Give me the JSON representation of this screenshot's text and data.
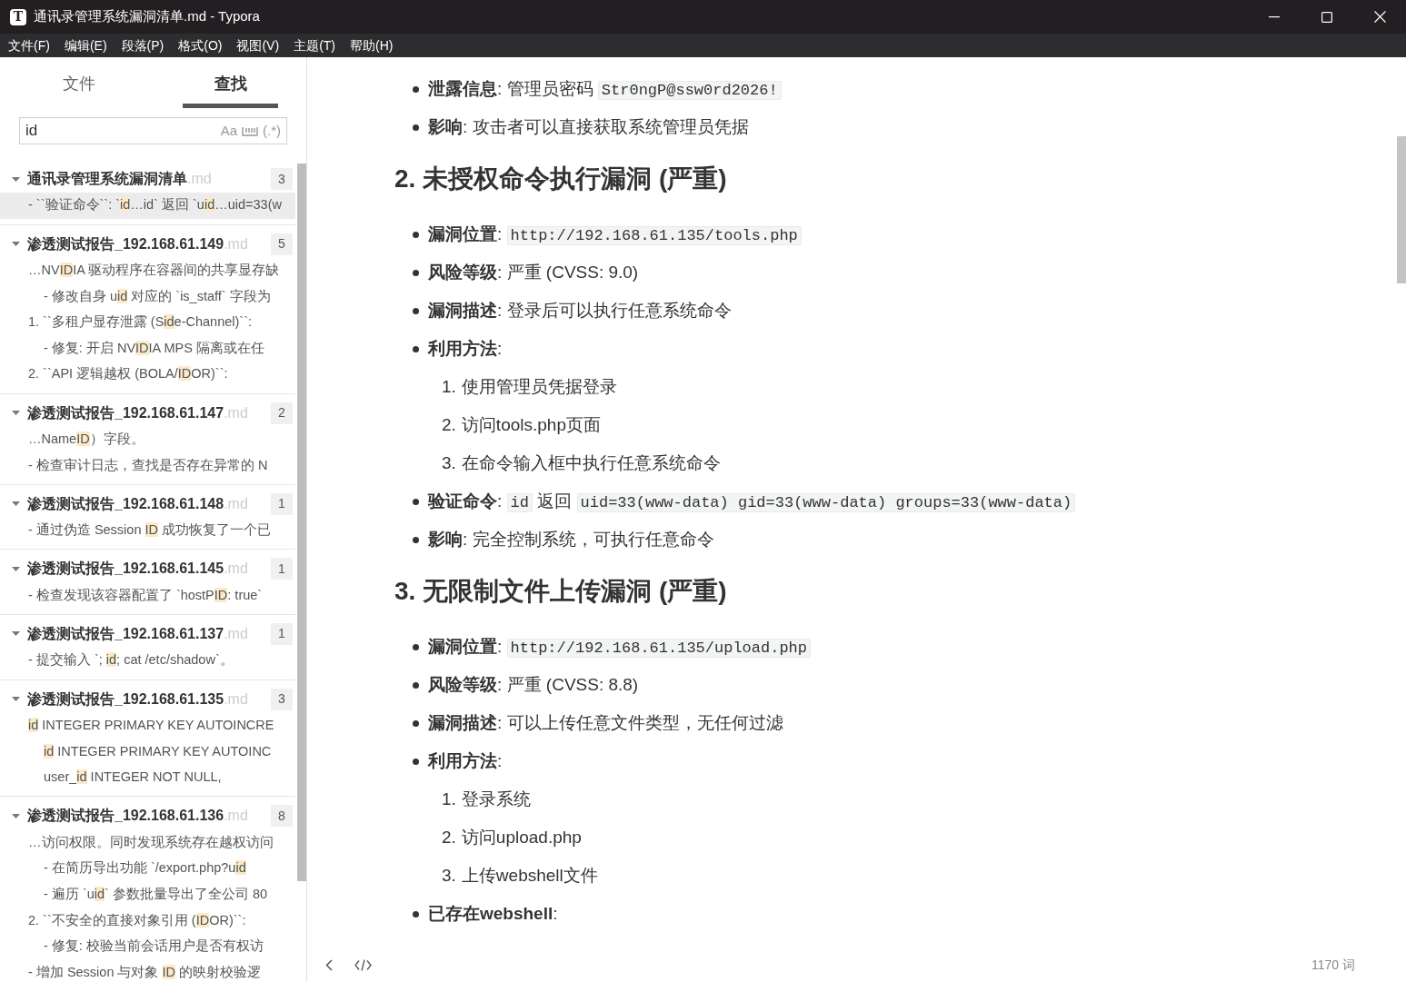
{
  "window": {
    "icon_text": "T",
    "title": "通讯录管理系统漏洞清单.md - Typora"
  },
  "menu": [
    "文件(F)",
    "编辑(E)",
    "段落(P)",
    "格式(O)",
    "视图(V)",
    "主题(T)",
    "帮助(H)"
  ],
  "sidebar": {
    "tabs": [
      {
        "label": "文件",
        "selected": false
      },
      {
        "label": "查找",
        "selected": true
      }
    ],
    "search": {
      "value": "id",
      "options": [
        {
          "kind": "text",
          "label": "Aa"
        },
        {
          "kind": "whole-word"
        },
        {
          "kind": "text",
          "label": "(.*)"
        }
      ]
    },
    "results": [
      {
        "name": "通讯录管理系统漏洞清单",
        "ext": ".md",
        "count": "3",
        "expanded": true,
        "matches": [
          {
            "selected": true,
            "indented": false,
            "segments": [
              {
                "text": "- ``验证命令``: `",
                "highlighted": false
              },
              {
                "text": "id",
                "highlighted": true
              },
              {
                "text": "…id` 返回 `u",
                "highlighted": false
              },
              {
                "text": "id",
                "highlighted": true
              },
              {
                "text": "…uid=33(w",
                "highlighted": false
              }
            ]
          }
        ]
      },
      {
        "name": "渗透测试报告_192.168.61.149",
        "ext": ".md",
        "count": "5",
        "expanded": true,
        "matches": [
          {
            "selected": false,
            "indented": false,
            "segments": [
              {
                "text": "…NV",
                "highlighted": false
              },
              {
                "text": "ID",
                "highlighted": true
              },
              {
                "text": "IA 驱动程序在容器间的共享显存缺",
                "highlighted": false
              }
            ]
          },
          {
            "selected": false,
            "indented": true,
            "segments": [
              {
                "text": "- 修改自身 u",
                "highlighted": false
              },
              {
                "text": "id",
                "highlighted": true
              },
              {
                "text": " 对应的 `is_staff` 字段为",
                "highlighted": false
              }
            ]
          },
          {
            "selected": false,
            "indented": false,
            "segments": [
              {
                "text": "1. ``多租户显存泄露 (S",
                "highlighted": false
              },
              {
                "text": "id",
                "highlighted": true
              },
              {
                "text": "e-Channel)``:",
                "highlighted": false
              }
            ]
          },
          {
            "selected": false,
            "indented": true,
            "segments": [
              {
                "text": "- 修复: 开启 NV",
                "highlighted": false
              },
              {
                "text": "ID",
                "highlighted": true
              },
              {
                "text": "IA MPS 隔离或在任",
                "highlighted": false
              }
            ]
          },
          {
            "selected": false,
            "indented": false,
            "segments": [
              {
                "text": "2. ``API 逻辑越权 (BOLA/",
                "highlighted": false
              },
              {
                "text": "ID",
                "highlighted": true
              },
              {
                "text": "OR)``:",
                "highlighted": false
              }
            ]
          }
        ]
      },
      {
        "name": "渗透测试报告_192.168.61.147",
        "ext": ".md",
        "count": "2",
        "expanded": true,
        "matches": [
          {
            "selected": false,
            "indented": false,
            "segments": [
              {
                "text": "…Name",
                "highlighted": false
              },
              {
                "text": "ID",
                "highlighted": true
              },
              {
                "text": "）字段。",
                "highlighted": false
              }
            ]
          },
          {
            "selected": false,
            "indented": false,
            "segments": [
              {
                "text": "- 检查审计日志，查找是否存在异常的 N",
                "highlighted": false
              }
            ]
          }
        ]
      },
      {
        "name": "渗透测试报告_192.168.61.148",
        "ext": ".md",
        "count": "1",
        "expanded": true,
        "matches": [
          {
            "selected": false,
            "indented": false,
            "segments": [
              {
                "text": "- 通过伪造 Session ",
                "highlighted": false
              },
              {
                "text": "ID",
                "highlighted": true
              },
              {
                "text": " 成功恢复了一个已",
                "highlighted": false
              }
            ]
          }
        ]
      },
      {
        "name": "渗透测试报告_192.168.61.145",
        "ext": ".md",
        "count": "1",
        "expanded": true,
        "matches": [
          {
            "selected": false,
            "indented": false,
            "segments": [
              {
                "text": "- 检查发现该容器配置了 `hostP",
                "highlighted": false
              },
              {
                "text": "ID",
                "highlighted": true
              },
              {
                "text": ": true`",
                "highlighted": false
              }
            ]
          }
        ]
      },
      {
        "name": "渗透测试报告_192.168.61.137",
        "ext": ".md",
        "count": "1",
        "expanded": true,
        "matches": [
          {
            "selected": false,
            "indented": false,
            "segments": [
              {
                "text": "- 提交输入 `; ",
                "highlighted": false
              },
              {
                "text": "id",
                "highlighted": true
              },
              {
                "text": "; cat /etc/shadow`。",
                "highlighted": false
              }
            ]
          }
        ]
      },
      {
        "name": "渗透测试报告_192.168.61.135",
        "ext": ".md",
        "count": "3",
        "expanded": true,
        "matches": [
          {
            "selected": false,
            "indented": false,
            "segments": [
              {
                "text": "id",
                "highlighted": true
              },
              {
                "text": " INTEGER PRIMARY KEY AUTOINCRE",
                "highlighted": false
              }
            ]
          },
          {
            "selected": false,
            "indented": true,
            "segments": [
              {
                "text": "id",
                "highlighted": true
              },
              {
                "text": " INTEGER PRIMARY KEY AUTOINC",
                "highlighted": false
              }
            ]
          },
          {
            "selected": false,
            "indented": true,
            "segments": [
              {
                "text": "user_",
                "highlighted": false
              },
              {
                "text": "id",
                "highlighted": true
              },
              {
                "text": " INTEGER NOT NULL,",
                "highlighted": false
              }
            ]
          }
        ]
      },
      {
        "name": "渗透测试报告_192.168.61.136",
        "ext": ".md",
        "count": "8",
        "expanded": true,
        "matches": [
          {
            "selected": false,
            "indented": false,
            "segments": [
              {
                "text": "…访问权限。同时发现系统存在越权访问",
                "highlighted": false
              }
            ]
          },
          {
            "selected": false,
            "indented": true,
            "segments": [
              {
                "text": "- 在简历导出功能 `/export.php?u",
                "highlighted": false
              },
              {
                "text": "id",
                "highlighted": true
              }
            ]
          },
          {
            "selected": false,
            "indented": true,
            "segments": [
              {
                "text": "- 遍历 `u",
                "highlighted": false
              },
              {
                "text": "id",
                "highlighted": true
              },
              {
                "text": "` 参数批量导出了全公司 80",
                "highlighted": false
              }
            ]
          },
          {
            "selected": false,
            "indented": false,
            "segments": [
              {
                "text": "2. ``不安全的直接对象引用 (",
                "highlighted": false
              },
              {
                "text": "ID",
                "highlighted": true
              },
              {
                "text": "OR)``:",
                "highlighted": false
              }
            ]
          },
          {
            "selected": false,
            "indented": true,
            "segments": [
              {
                "text": "- 修复: 校验当前会话用户是否有权访",
                "highlighted": false
              }
            ]
          },
          {
            "selected": false,
            "indented": false,
            "segments": [
              {
                "text": "- 增加 Session 与对象 ",
                "highlighted": false
              },
              {
                "text": "ID",
                "highlighted": true
              },
              {
                "text": " 的映射校验逻",
                "highlighted": false
              }
            ]
          }
        ]
      }
    ]
  },
  "document": [
    {
      "kind": "bullet",
      "segments": [
        {
          "kind": "text",
          "text": "**泄露信息**: 管理员密码 "
        },
        {
          "kind": "code",
          "text": "Str0ngP@ssw0rd2026!"
        }
      ]
    },
    {
      "kind": "bullet",
      "segments": [
        {
          "kind": "text",
          "text": "**影响**: 攻击者可以直接获取系统管理员凭据"
        }
      ]
    },
    {
      "kind": "heading",
      "text": "2. 未授权命令执行漏洞 (严重)"
    },
    {
      "kind": "bullet",
      "segments": [
        {
          "kind": "text",
          "text": "**漏洞位置**: "
        },
        {
          "kind": "code",
          "text": "http://192.168.61.135/tools.php"
        }
      ]
    },
    {
      "kind": "bullet",
      "segments": [
        {
          "kind": "text",
          "text": "**风险等级**: 严重 (CVSS: 9.0)"
        }
      ]
    },
    {
      "kind": "bullet",
      "segments": [
        {
          "kind": "text",
          "text": "**漏洞描述**: 登录后可以执行任意系统命令"
        }
      ]
    },
    {
      "kind": "bullet",
      "segments": [
        {
          "kind": "text",
          "text": "**利用方法**:"
        }
      ]
    },
    {
      "kind": "ordered",
      "number": "1.",
      "text": "使用管理员凭据登录"
    },
    {
      "kind": "ordered",
      "number": "2.",
      "text": "访问tools.php页面"
    },
    {
      "kind": "ordered",
      "number": "3.",
      "text": "在命令输入框中执行任意系统命令"
    },
    {
      "kind": "bullet",
      "segments": [
        {
          "kind": "text",
          "text": "**验证命令**: "
        },
        {
          "kind": "code",
          "text": "id"
        },
        {
          "kind": "text",
          "text": " 返回 "
        },
        {
          "kind": "code",
          "text": "uid=33(www-data) gid=33(www-data) groups=33(www-data)"
        }
      ]
    },
    {
      "kind": "bullet",
      "segments": [
        {
          "kind": "text",
          "text": "**影响**: 完全控制系统，可执行任意命令"
        }
      ]
    },
    {
      "kind": "heading",
      "text": "3. 无限制文件上传漏洞 (严重)"
    },
    {
      "kind": "bullet",
      "segments": [
        {
          "kind": "text",
          "text": "**漏洞位置**: "
        },
        {
          "kind": "code",
          "text": "http://192.168.61.135/upload.php"
        }
      ]
    },
    {
      "kind": "bullet",
      "segments": [
        {
          "kind": "text",
          "text": "**风险等级**: 严重 (CVSS: 8.8)"
        }
      ]
    },
    {
      "kind": "bullet",
      "segments": [
        {
          "kind": "text",
          "text": "**漏洞描述**: 可以上传任意文件类型，无任何过滤"
        }
      ]
    },
    {
      "kind": "bullet",
      "segments": [
        {
          "kind": "text",
          "text": "**利用方法**:"
        }
      ]
    },
    {
      "kind": "ordered",
      "number": "1.",
      "text": "登录系统"
    },
    {
      "kind": "ordered",
      "number": "2.",
      "text": "访问upload.php"
    },
    {
      "kind": "ordered",
      "number": "3.",
      "text": "上传webshell文件"
    },
    {
      "kind": "bullet",
      "segments": [
        {
          "kind": "text",
          "text": "**已存在webshell**:"
        }
      ]
    }
  ],
  "status_bar": {
    "word_count": "1170 词"
  }
}
